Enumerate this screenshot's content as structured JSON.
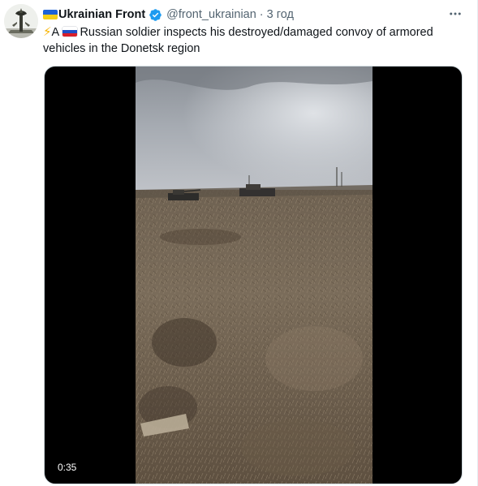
{
  "tweet": {
    "display_name": "Ukrainian Front",
    "handle": "@front_ukrainian",
    "separator": "·",
    "time": "3 год",
    "text_prefix": "A",
    "text_body": "Russian soldier inspects his destroyed/damaged convoy of armored vehicles in the Donetsk region"
  },
  "media": {
    "duration": "0:35"
  },
  "icons": {
    "author_flag": "ukraine-flag-icon",
    "verified": "verified-badge-icon",
    "more": "more-options-icon",
    "bolt": "lightning-bolt-icon",
    "text_flag": "russia-flag-icon"
  },
  "colors": {
    "verified_blue": "#1d9bf0",
    "secondary_text": "#536471",
    "primary_text": "#0f1419"
  }
}
